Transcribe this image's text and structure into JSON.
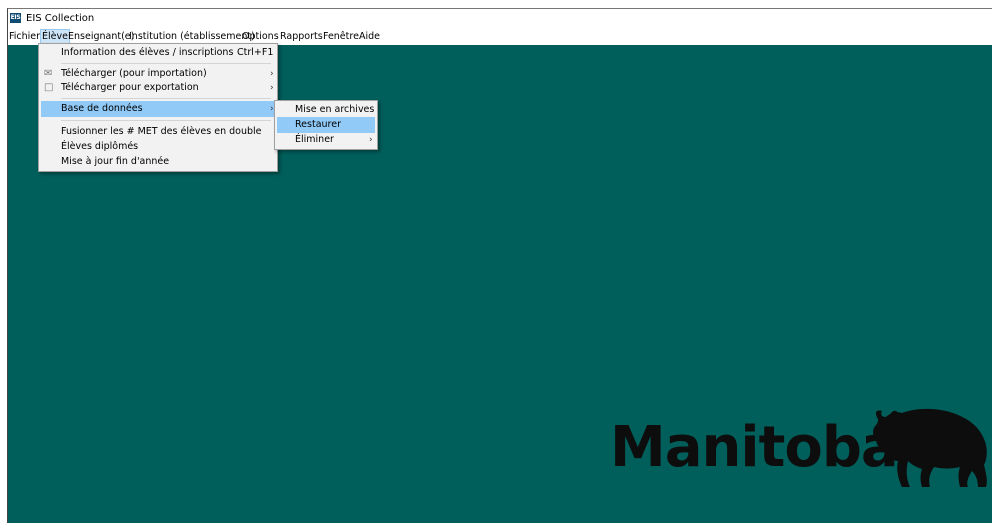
{
  "window": {
    "icon_text": "EIS",
    "title": "EIS Collection"
  },
  "menubar": {
    "items": [
      "Fichier",
      "Élève",
      "Enseignant(e)",
      "Institution (établissement)",
      "Options",
      "Rapports",
      "Fenêtre",
      "Aide"
    ],
    "active": "Élève"
  },
  "eleve_menu": {
    "items": [
      {
        "label": "Information des élèves / inscriptions",
        "shortcut": "Ctrl+F1"
      },
      {
        "label": "Télécharger (pour importation)",
        "submenu": true,
        "icon": "import-icon"
      },
      {
        "label": "Télécharger pour exportation",
        "submenu": true,
        "icon": "export-icon"
      },
      {
        "label": "Base de données",
        "submenu": true,
        "highlighted": true
      },
      {
        "label": "Fusionner les # MET des élèves en double"
      },
      {
        "label": "Élèves diplômés"
      },
      {
        "label": "Mise à jour fin d'année"
      }
    ]
  },
  "database_submenu": {
    "items": [
      {
        "label": "Mise en archives"
      },
      {
        "label": "Restaurer",
        "highlighted": true
      },
      {
        "label": "Éliminer",
        "submenu": true
      }
    ]
  },
  "logo": {
    "text": "Manitoba",
    "icon": "bison-icon"
  },
  "colors": {
    "desktop": "#005f5b",
    "menu_highlight": "#91c9f7",
    "logo": "#0d0d0d"
  }
}
